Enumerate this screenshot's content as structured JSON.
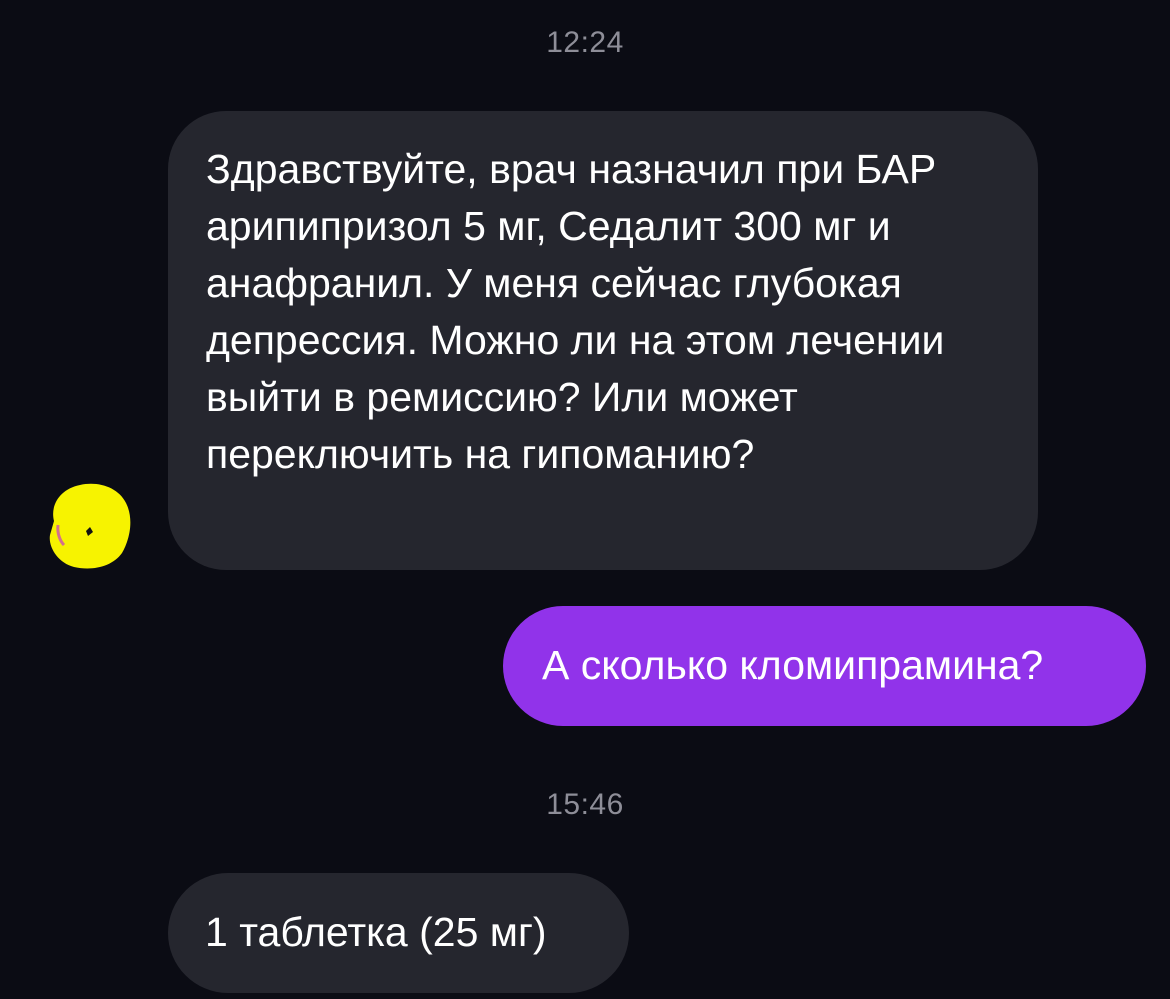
{
  "conversation": {
    "timestamps": [
      "12:24",
      "15:46"
    ],
    "messages": [
      {
        "direction": "incoming",
        "text": "Здравствуйте, врач назначил при БАР арипипризол 5 мг, Седалит 300 мг и анафранил. У меня сейчас глубокая депрессия. Можно ли на этом лечении выйти в ремиссию? Или может переключить на гипоманию?"
      },
      {
        "direction": "outgoing",
        "text": "А сколько кломипрамина?"
      },
      {
        "direction": "incoming",
        "text": "1 таблетка (25 мг)"
      }
    ],
    "avatar": {
      "icon": "user-avatar-icon",
      "color": "#f7f300"
    }
  },
  "theme": {
    "background": "#0b0c14",
    "incoming_bubble": "#25262e",
    "outgoing_bubble": "#9133ea",
    "timestamp_color": "#8e8e98",
    "text_color": "#ffffff"
  }
}
